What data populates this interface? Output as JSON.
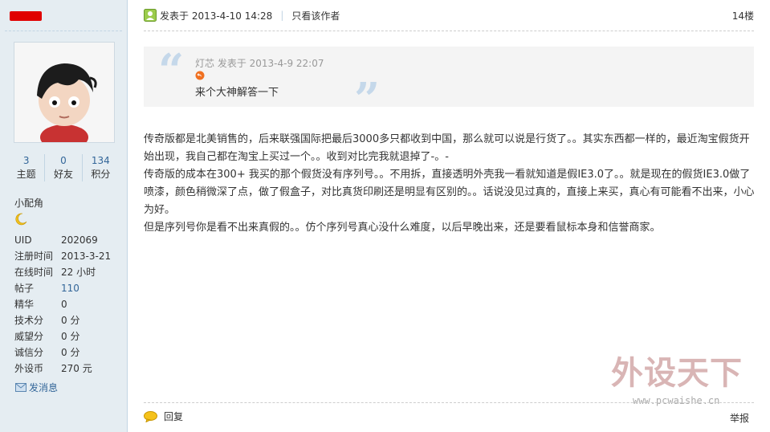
{
  "sidebar": {
    "stats": [
      {
        "value": "3",
        "label": "主题"
      },
      {
        "value": "0",
        "label": "好友"
      },
      {
        "value": "134",
        "label": "积分"
      }
    ],
    "group": "小配角",
    "profile": [
      {
        "key": "UID",
        "value": "202069"
      },
      {
        "key": "注册时间",
        "value": "2013-3-21"
      },
      {
        "key": "在线时间",
        "value": "22 小时"
      },
      {
        "key": "帖子",
        "value": "110"
      },
      {
        "key": "精华",
        "value": "0"
      },
      {
        "key": "技术分",
        "value": "0 分"
      },
      {
        "key": "威望分",
        "value": "0 分"
      },
      {
        "key": "诚信分",
        "value": "0 分"
      },
      {
        "key": "外设币",
        "value": "270 元"
      }
    ],
    "send_message": "发消息"
  },
  "post": {
    "posted_at": "发表于 2013-4-10 14:28",
    "only_author": "只看该作者",
    "floor": "14楼",
    "quote": {
      "meta": "灯芯 发表于 2013-4-9 22:07",
      "text": "来个大神解答一下"
    },
    "body": [
      "传奇版都是北美销售的，后来联强国际把最后3000多只都收到中国，那么就可以说是行货了。。其实东西都一样的，最近淘宝假货开始出现，我自己都在淘宝上买过一个。。收到对比完我就退掉了-。-",
      "传奇版的成本在300+    我买的那个假货没有序列号。。不用拆，直接透明外壳我一看就知道是假IE3.0了。。就是现在的假货IE3.0做了喷漆，颜色稍微深了点，做了假盒子，对比真货印刷还是明显有区别的。。话说没见过真的，直接上来买，真心有可能看不出来，小心为好。",
      "但是序列号你是看不出来真假的。。仿个序列号真心没什么难度，以后早晚出来，还是要看鼠标本身和信誉商家。"
    ],
    "reply": "回复",
    "report": "举报"
  },
  "watermark": {
    "title": "外设天下",
    "url": "www.pcwaishe.cn"
  },
  "colors": {
    "sidebar_bg": "#e5edf2",
    "link": "#336699",
    "redaction": "#e00000"
  }
}
